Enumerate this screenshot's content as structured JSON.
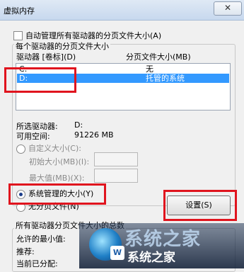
{
  "window": {
    "title": "虚拟内存",
    "close_glyph": "✕"
  },
  "auto_manage": {
    "label": "自动管理所有驱动器的分页文件大小(A)",
    "checked": false
  },
  "per_drive": {
    "group_title": "每个驱动器的分页文件大小",
    "columns": [
      "驱动器 [卷标](D)",
      "分页文件大小(MB)"
    ],
    "rows": [
      {
        "drive": "C:",
        "size": "无",
        "selected": false
      },
      {
        "drive": "D:",
        "size": "托管的系统",
        "selected": true
      }
    ],
    "selected_drive_label": "所选驱动器:",
    "selected_drive_value": "D:",
    "free_space_label": "可用空间:",
    "free_space_value": "91226 MB",
    "custom_size_label": "自定义大小(C):",
    "initial_size_label": "初始大小(MB)(I):",
    "max_size_label": "最大值(MB)(X):",
    "system_managed_label": "系统管理的大小(Y)",
    "no_paging_label": "无分页文件(N)",
    "set_button": "设置(S)"
  },
  "totals": {
    "group_title": "所有驱动器分页文件大小的总数",
    "min_allowed_label": "允许的最小值:",
    "recommended_label": "推荐:",
    "currently_allocated_label": "当前已分配:"
  },
  "watermark": {
    "large_text": "系统之家",
    "small_text": "系统之家",
    "icon_glyph": "W"
  },
  "colors": {
    "selection": "#3399ff",
    "highlight_box": "#e0141e"
  }
}
